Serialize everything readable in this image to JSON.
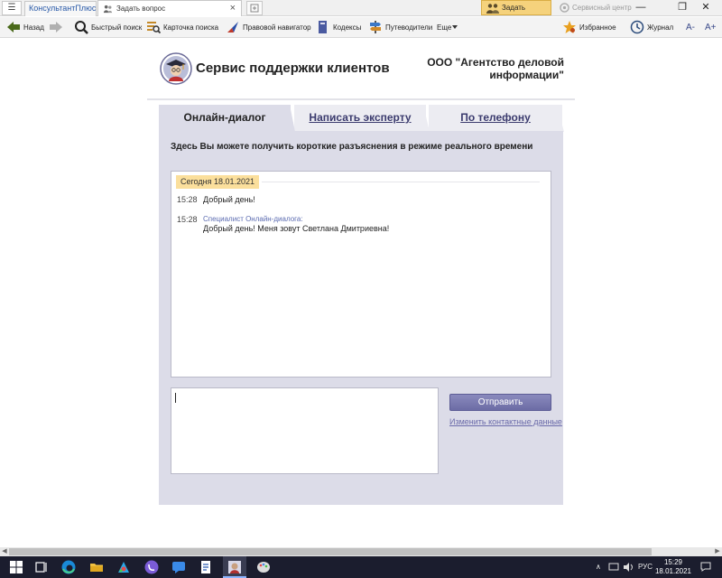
{
  "titlebar": {
    "menu_glyph": "☰",
    "app_tab": "КонсультантПлюс",
    "active_tab": "Задать вопрос",
    "ask_button": "Задать вопрос",
    "service_center": "Сервисный центр"
  },
  "toolbar": {
    "back": "Назад",
    "quick_search": "Быстрый поиск",
    "search_card": "Карточка поиска",
    "legal_navigator": "Правовой навигатор",
    "codes": "Кодексы",
    "guides": "Путеводители",
    "more": "Еще",
    "favorites": "Избранное",
    "journal": "Журнал",
    "font_decrease": "A-",
    "font_increase": "A+"
  },
  "page": {
    "title": "Сервис поддержки клиентов",
    "org_name": "ООО \"Агентство деловой информации\""
  },
  "tabs": [
    {
      "label": "Онлайн-диалог",
      "active": true
    },
    {
      "label": "Написать эксперту",
      "active": false
    },
    {
      "label": "По телефону",
      "active": false
    }
  ],
  "intro_text": "Здесь Вы можете получить короткие разъяснения в режиме реального времени",
  "chat": {
    "date_label": "Сегодня 18.01.2021",
    "messages": [
      {
        "time": "15:28",
        "author": "",
        "text": "Добрый день!"
      },
      {
        "time": "15:28",
        "author": "Специалист Онлайн-диалога:",
        "text": "Добрый день! Меня зовут Светлана Дмитриевна!"
      }
    ]
  },
  "input": {
    "value": ""
  },
  "send_button": "Отправить",
  "contact_link": "Изменить контактные данные",
  "taskbar": {
    "language": "РУС",
    "time": "15:29",
    "date": "18.01.2021"
  },
  "colors": {
    "panel_bg": "#dcdce8",
    "inactive_tab_bg": "#ececf2",
    "send_button": "#7474ad",
    "date_badge": "#fbdf9c",
    "ask_button_bg": "#f5d27c",
    "taskbar_bg": "#1b1d2e"
  }
}
